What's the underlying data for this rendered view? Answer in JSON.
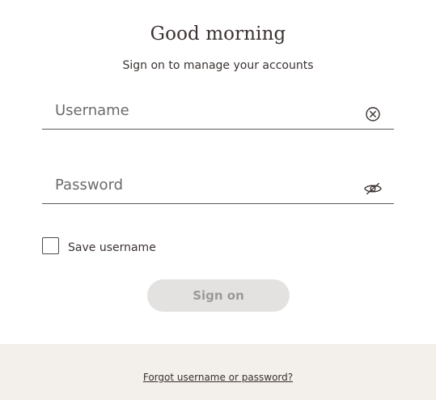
{
  "header": {
    "title": "Good morning",
    "subtitle": "Sign on to manage your accounts"
  },
  "form": {
    "username": {
      "placeholder": "Username",
      "value": "",
      "icon": "clear-icon"
    },
    "password": {
      "placeholder": "Password",
      "value": "",
      "icon": "eye-hidden-icon"
    },
    "save_username": {
      "label": "Save username",
      "checked": false
    },
    "submit_label": "Sign on"
  },
  "footer": {
    "forgot_link": "Forgot username or password?"
  },
  "colors": {
    "text": "#3b3331",
    "button_disabled_bg": "#e4e2e0",
    "button_disabled_text": "#9c9896",
    "footer_bg": "#f3efeb"
  }
}
